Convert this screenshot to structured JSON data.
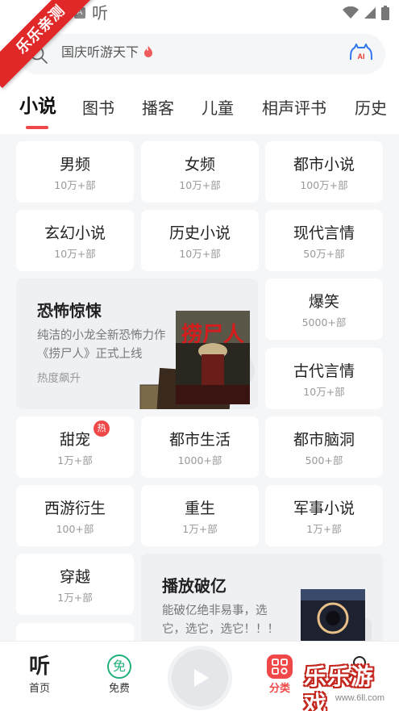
{
  "watermark": {
    "ribbon": "乐乐亲测",
    "brand": "乐乐游戏",
    "url": "www.6ll.com"
  },
  "status_bar": {
    "a_badge": "A",
    "app_glyph": "听"
  },
  "search": {
    "text": "国庆听游天下",
    "ai_label": "AI"
  },
  "tabs": [
    {
      "label": "小说"
    },
    {
      "label": "图书"
    },
    {
      "label": "播客"
    },
    {
      "label": "儿童"
    },
    {
      "label": "相声评书"
    },
    {
      "label": "历史"
    }
  ],
  "active_tab": "小说",
  "categories": {
    "male": {
      "name": "男频",
      "count": "10万+部"
    },
    "female": {
      "name": "女频",
      "count": "10万+部"
    },
    "urban_novel": {
      "name": "都市小说",
      "count": "100万+部"
    },
    "fantasy": {
      "name": "玄幻小说",
      "count": "10万+部"
    },
    "history_novel": {
      "name": "历史小说",
      "count": "10万+部"
    },
    "modern_romance": {
      "name": "现代言情",
      "count": "50万+部"
    },
    "funny": {
      "name": "爆笑",
      "count": "5000+部"
    },
    "ancient_romance": {
      "name": "古代言情",
      "count": "10万+部"
    },
    "sweet": {
      "name": "甜宠",
      "count": "1万+部",
      "badge": "热"
    },
    "urban_life": {
      "name": "都市生活",
      "count": "1000+部"
    },
    "urban_brainhole": {
      "name": "都市脑洞",
      "count": "500+部"
    },
    "journey_west": {
      "name": "西游衍生",
      "count": "100+部"
    },
    "rebirth": {
      "name": "重生",
      "count": "1万+部"
    },
    "military": {
      "name": "军事小说",
      "count": "1万+部"
    },
    "time_travel": {
      "name": "穿越",
      "count": "1万+部"
    }
  },
  "features": {
    "horror": {
      "title": "恐怖惊悚",
      "desc": "纯洁的小龙全新恐怖力作《捞尸人》正式上线",
      "sub": "热度飙升",
      "cover_text": "捞尸人"
    },
    "billion": {
      "title": "播放破亿",
      "desc": "能破亿绝非易事，选它，选它，选它！！！"
    }
  },
  "bottom_nav": {
    "home": "首页",
    "home_glyph": "听",
    "free": "免费",
    "free_glyph": "免",
    "category": "分类"
  },
  "colors": {
    "accent": "#f04848",
    "free_green": "#20b07a",
    "ribbon": "#e02828"
  }
}
